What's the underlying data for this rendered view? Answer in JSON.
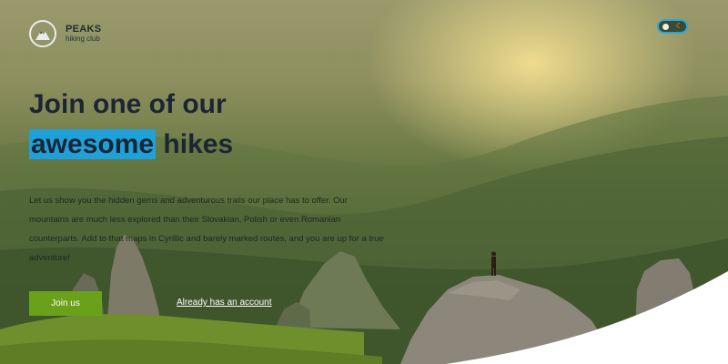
{
  "brand": {
    "name": "PEAKS",
    "tagline": "hiking club",
    "logo_icon": "mountain-icon"
  },
  "theme_toggle": {
    "sun_icon": "sun-icon",
    "moon_icon": "moon-icon",
    "moon_glyph": "☾",
    "accent": "#2aa7d7"
  },
  "hero": {
    "title_line1": "Join one of our",
    "title_highlight": "awesome",
    "title_rest": " hikes",
    "highlight_color": "#1fa0d8",
    "description": "Let us show you the hidden gems and adventurous trails our place has to offer. Our mountains are much less explored than their Slovakian, Polish or even Romanian counterparts. Add to that maps in Cyrillic and barely marked routes, and you are up for a true adventure!"
  },
  "actions": {
    "join_label": "Join us",
    "join_color": "#6aa11a",
    "account_link": "Already has an account"
  }
}
